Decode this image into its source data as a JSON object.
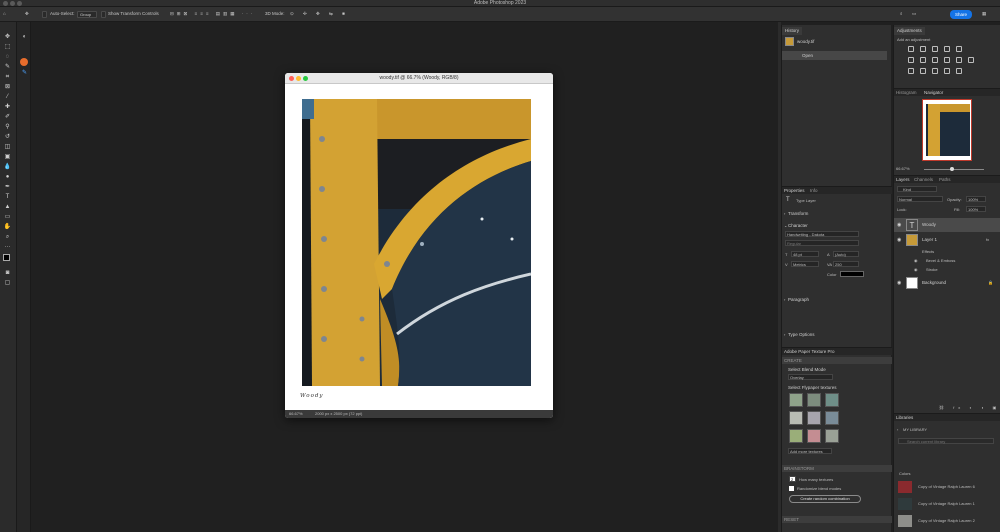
{
  "app": {
    "title": "Adobe Photoshop 2023"
  },
  "options_bar": {
    "auto_select_label": "Auto-Select:",
    "auto_select_value": "Group",
    "transform_label": "Show Transform Controls",
    "mode_3d": "3D Mode:",
    "share_label": "Share"
  },
  "document": {
    "title": "woody.tif @ 66.7% (Woody, RGB/8)",
    "zoom": "66.67%",
    "dimensions": "2000 px x 2500 px (72 ppi)",
    "signature": "Woody"
  },
  "history_panel": {
    "tab": "History",
    "snapshot": "woody.tif",
    "items": [
      "Open"
    ]
  },
  "properties_panel": {
    "tabs": [
      "Properties",
      "Info"
    ],
    "layer_type": "Type Layer",
    "transform_label": "Transform",
    "character_label": "Character",
    "font_family": "Handwriting - Dakota",
    "font_style": "Regular",
    "font_size": "48 pt",
    "leading": "(Auto)",
    "kerning": "Metrics",
    "tracking": "250",
    "color_label": "Color",
    "paragraph_label": "Paragraph",
    "type_options_label": "Type Options"
  },
  "texture_panel": {
    "title": "Adobe Paper Texture Pro",
    "create_label": "CREATE",
    "blend_label": "Select Blend Mode",
    "blend_value": "Overlay",
    "textures_label": "Select Flypaper textures",
    "more_textures": "Add more textures",
    "brainstorm_label": "BRAINSTORM",
    "how_many_value": "2",
    "how_many_label": "How many textures",
    "randomize_label": "Randomize blend modes",
    "create_random_btn": "Create random combination",
    "reset_label": "RESET",
    "texture_colors": [
      "#8fa38a",
      "#7d8d7e",
      "#6f8f88",
      "#b9bcb4",
      "#a7a5ad",
      "#7a8c98",
      "#9aae79",
      "#c48d92",
      "#9aa196"
    ]
  },
  "adjustments_panel": {
    "tab": "Adjustments",
    "subtitle": "Add an adjustment"
  },
  "navigator_panel": {
    "tabs": [
      "Histogram",
      "Navigator"
    ],
    "zoom": "66.67%"
  },
  "layers_panel": {
    "tabs": [
      "Layers",
      "Channels",
      "Paths"
    ],
    "kind": "Kind",
    "blend_mode": "Normal",
    "opacity_label": "Opacity:",
    "opacity_value": "100%",
    "lock_label": "Lock:",
    "fill_label": "Fill:",
    "fill_value": "100%",
    "layers": [
      {
        "name": "Woody",
        "type": "text"
      },
      {
        "name": "Layer 1",
        "type": "image",
        "fx": "fx"
      },
      {
        "name": "Effects",
        "type": "effect-group"
      },
      {
        "name": "Bevel & Emboss",
        "type": "effect"
      },
      {
        "name": "Stroke",
        "type": "effect"
      },
      {
        "name": "Background",
        "type": "background"
      }
    ]
  },
  "libraries_panel": {
    "tab": "Libraries",
    "library_name": "MY LIBRARY",
    "search_placeholder": "Search current library",
    "colors_label": "Colors",
    "colors": [
      {
        "name": "Copy of Vintage Ralph Lauren 6",
        "hex": "#8a2a2e"
      },
      {
        "name": "Copy of Vintage Ralph Lauren 1",
        "hex": "#2f3a3c"
      },
      {
        "name": "Copy of Vintage Ralph Lauren 2",
        "hex": "#8e8e8a"
      }
    ]
  }
}
